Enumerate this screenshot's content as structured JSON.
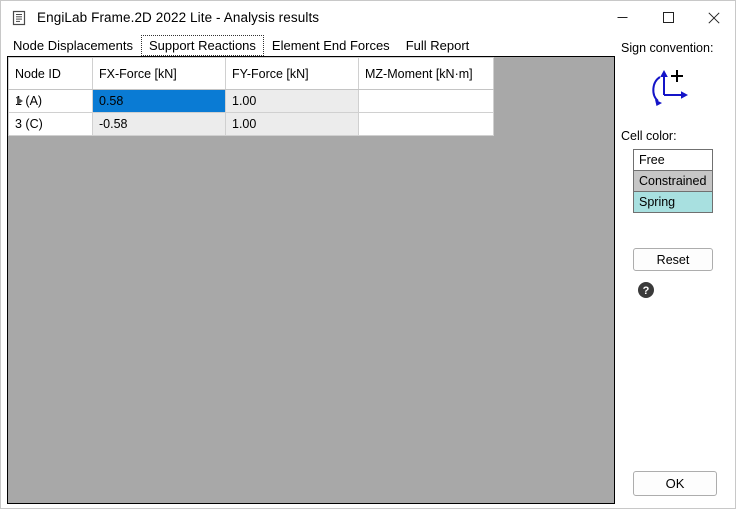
{
  "window": {
    "title": "EngiLab Frame.2D 2022 Lite - Analysis results",
    "icon": "document-report-icon",
    "controls": {
      "minimize": "minimize-icon",
      "maximize": "maximize-icon",
      "close": "close-icon"
    }
  },
  "tabs": [
    {
      "label": "Node Displacements",
      "active": false
    },
    {
      "label": "Support Reactions",
      "active": true
    },
    {
      "label": "Element End Forces",
      "active": false
    },
    {
      "label": "Full Report",
      "active": false
    }
  ],
  "table": {
    "columns": [
      "Node ID",
      "FX-Force [kN]",
      "FY-Force [kN]",
      "MZ-Moment [kN·m]"
    ],
    "rows": [
      {
        "node": "1 (A)",
        "marker": true,
        "fx": {
          "value": "0.58",
          "state": "constrained",
          "selected": true
        },
        "fy": {
          "value": "1.00",
          "state": "constrained",
          "selected": false
        },
        "mz": {
          "value": "",
          "state": "free",
          "selected": false
        }
      },
      {
        "node": "3 (C)",
        "marker": false,
        "fx": {
          "value": "-0.58",
          "state": "constrained",
          "selected": false
        },
        "fy": {
          "value": "1.00",
          "state": "constrained",
          "selected": false
        },
        "mz": {
          "value": "",
          "state": "free",
          "selected": false
        }
      }
    ]
  },
  "sidebar": {
    "sign_convention_label": "Sign convention:",
    "sign_convention_icon": "axes-sign-convention-icon",
    "cell_color_label": "Cell color:",
    "legend": [
      {
        "label": "Free",
        "color": "#ffffff"
      },
      {
        "label": "Constrained",
        "color": "#c6c6c6"
      },
      {
        "label": "Spring",
        "color": "#a8e0e0"
      }
    ],
    "reset_label": "Reset",
    "help_icon": "help-question-icon"
  },
  "footer": {
    "ok_label": "OK"
  },
  "colors": {
    "selection_blue": "#0a7bd4",
    "panel_grey": "#a8a8a8",
    "constrained_cell": "#ececec",
    "spring_cell": "#a8e0e0",
    "axis_blue": "#1414c8"
  }
}
